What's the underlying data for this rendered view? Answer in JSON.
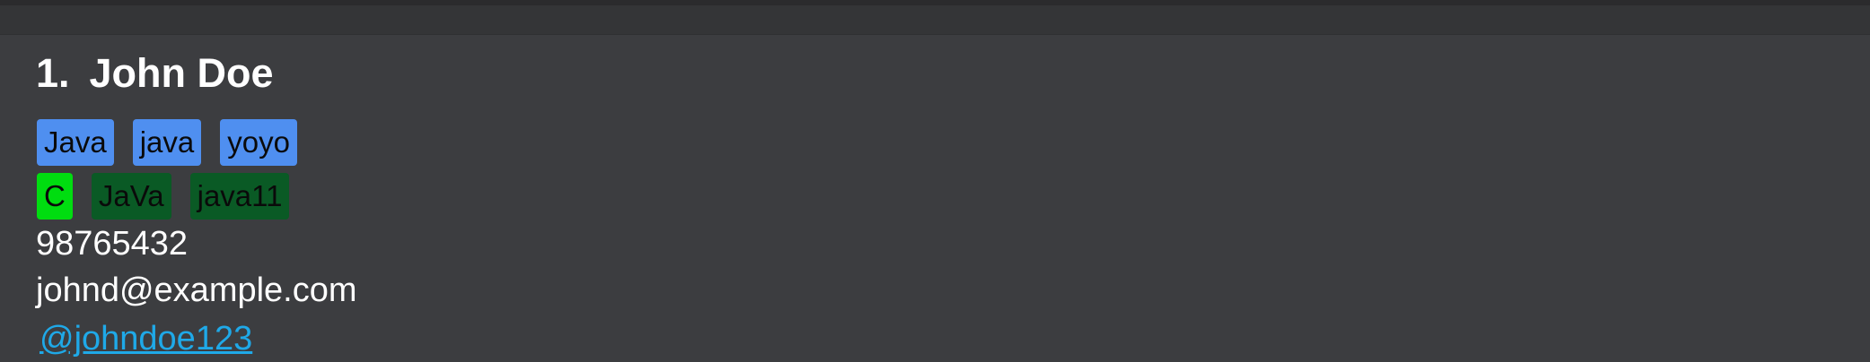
{
  "person": {
    "index": "1.",
    "name": "John Doe",
    "tags_primary": [
      "Java",
      "java",
      "yoyo"
    ],
    "tags_secondary": [
      "C",
      "JaVa",
      "java11"
    ],
    "phone": "98765432",
    "email": "johnd@example.com",
    "handle": "@johndoe123"
  },
  "colors": {
    "background": "#3c3d40",
    "tag_blue": "#4f8ff0",
    "tag_lime": "#00dd10",
    "tag_dark_green": "#0a5a25",
    "link": "#1fa9e8"
  }
}
